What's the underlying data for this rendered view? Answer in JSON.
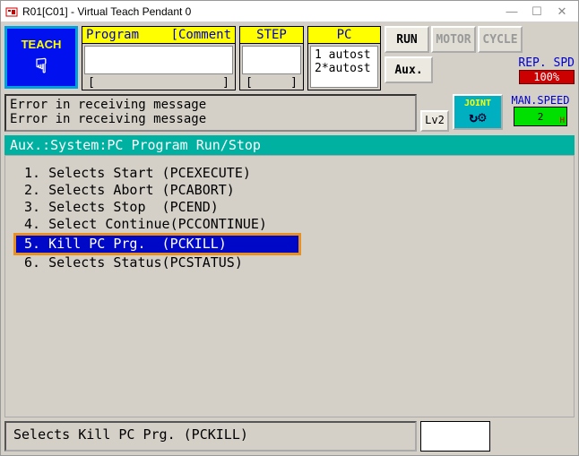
{
  "titlebar": {
    "title": "R01[C01] - Virtual Teach Pendant 0"
  },
  "teach_label": "TEACH",
  "prog_panel": {
    "header_left": "Program",
    "header_right": "[Comment",
    "footer_left": "[",
    "footer_right": "]"
  },
  "step_panel": {
    "header": "STEP",
    "footer_left": "[",
    "footer_right": "]"
  },
  "pc_panel": {
    "header": "PC",
    "line1": "1 autost",
    "line2": "2*autost"
  },
  "buttons": {
    "run": "RUN",
    "motor": "MOTOR",
    "cycle": "CYCLE",
    "aux": "Aux."
  },
  "rep_spd": {
    "label": "REP. SPD",
    "value": "100%"
  },
  "errors": {
    "line1": "Error in receiving message",
    "line2": "Error in receiving message"
  },
  "lv_label": "Lv2",
  "joint_label": "JOINT",
  "man_speed": {
    "label": "MAN.SPEED",
    "value": "2",
    "h": "H"
  },
  "menu": {
    "title": "Aux.:System:PC Program Run/Stop",
    "items": [
      {
        "n": "1.",
        "label": "Selects Start",
        "cmd": "(PCEXECUTE)"
      },
      {
        "n": "2.",
        "label": "Selects Abort",
        "cmd": "(PCABORT)"
      },
      {
        "n": "3.",
        "label": "Selects Stop",
        "cmd": "(PCEND)"
      },
      {
        "n": "4.",
        "label": "Select Continue",
        "cmd": "(PCCONTINUE)"
      },
      {
        "n": "5.",
        "label": "Kill PC Prg.",
        "cmd": "(PCKILL)"
      },
      {
        "n": "6.",
        "label": "Selects Status",
        "cmd": "(PCSTATUS)"
      }
    ],
    "selected_index": 4
  },
  "status_text": "Selects Kill PC Prg. (PCKILL)"
}
